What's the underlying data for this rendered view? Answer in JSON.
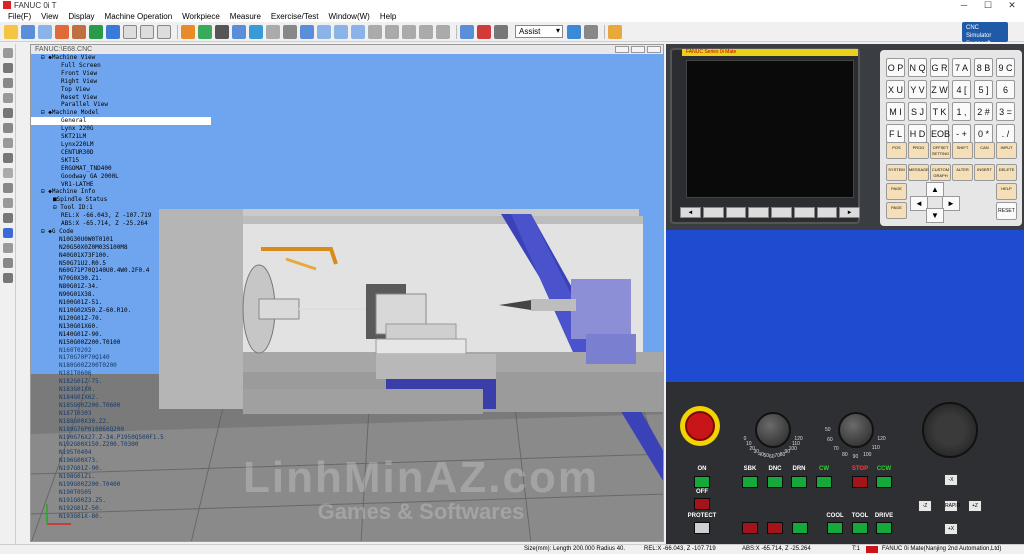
{
  "window": {
    "title": "FANUC 0i T"
  },
  "menu": [
    "File(F)",
    "View",
    "Display",
    "Machine Operation",
    "Workpiece",
    "Measure",
    "Exercise/Test",
    "Window(W)",
    "Help"
  ],
  "toolbar": {
    "mode_select": "Assist"
  },
  "brand": {
    "line1": "CNC Simulator",
    "line2": "Swansoft"
  },
  "inner_window": {
    "title": "FANUC:\\E68.CNC"
  },
  "tree": {
    "machine_view": {
      "label": "Machine View",
      "items": [
        "Full Screen",
        "Front View",
        "Right View",
        "Top View",
        "Reset View",
        "Parallel View"
      ]
    },
    "machine_model": {
      "label": "Machine Model",
      "items": [
        "General",
        "Lynx 220G",
        "SKT21LM",
        "Lynx220LM",
        "CENTUR30D",
        "SKT15",
        "ERGOMAT_TND400",
        "Goodway GA 2000L",
        "VR1-LATHE"
      ]
    },
    "machine_info": {
      "label": "Machine Info",
      "spindle": "Spindle Status",
      "tool": "Tool ID:1",
      "rel": "REL:X  -66.043, Z -107.719",
      "abs": "ABS:X  -65.714, Z  -25.264"
    },
    "gcode": {
      "label": "G Code",
      "lines": [
        "N10G30U0W0T0101",
        "N20G50X0Z0M03S100M8",
        "N40G01X73F100.",
        "N50G71U2.R0.5",
        "N60G71P70Q140U0.4W0.2F0.4",
        "N70G0X30.Z1.",
        "N80G01Z-34.",
        "N90G01X38.",
        "N100G01Z-51.",
        "N110G02X50.Z-60.R10.",
        "N120G01Z-70.",
        "N130G01X60.",
        "N140G01Z-90.",
        "N150G00Z200.T0100",
        "N160T0202",
        "N170G70P70Q140",
        "N180G00Z200T0200",
        "N181T0606",
        "N182G01Z-75.",
        "N183G01X0.",
        "N184G01X62.",
        "N185G00Z200.T0600",
        "N187T0303",
        "N188G00X30.Z2.",
        "N189G76P010060Q200",
        "N190G76X27.Z-34.P1950Q500F1.5",
        "N192G00X150.Z200.T0300",
        "N195T0404",
        "N196G00X73.",
        "N197G01Z-90.",
        "N198G01Z1.",
        "N199G00Z200.T0400",
        "N190T0505",
        "N191G00Z3.Z5.",
        "N192G01Z-50.",
        "N193G01X-80."
      ]
    }
  },
  "cnc_screen": {
    "label": "FANUC  Series 0i Mate"
  },
  "keypad": {
    "keys": [
      "O P",
      "N Q",
      "G R",
      "7 A",
      "8 B",
      "9 C",
      "X U",
      "Y V",
      "Z W",
      "4 [",
      "5 ]",
      "6 SP",
      "M I",
      "S J",
      "T K",
      "1 ,",
      "2 #",
      "3 =",
      "F L",
      "H D",
      "EOB E",
      "- +",
      "0 *",
      ". /"
    ],
    "func_keys": [
      "POS",
      "PROG",
      "OFFSET SETTING",
      "SHIFT",
      "CAN",
      "INPUT",
      "SYSTEM",
      "MESSAGE",
      "CUSTOM GRAPH",
      "ALTER",
      "INSERT",
      "DELETE"
    ],
    "page_up": "PAGE",
    "page_down": "PAGE",
    "help": "HELP",
    "reset": "RESET"
  },
  "operator_panel": {
    "feed_scale": [
      "0",
      "10",
      "20",
      "30",
      "40",
      "50",
      "60",
      "70",
      "80",
      "90",
      "100",
      "110",
      "120"
    ],
    "spindle_scale": [
      "50",
      "60",
      "70",
      "80",
      "90",
      "100",
      "110",
      "120"
    ],
    "buttons_row1": [
      {
        "label": "ON",
        "color": "green"
      },
      {
        "label": "SBK",
        "color": "green"
      },
      {
        "label": "DNC",
        "color": "green"
      },
      {
        "label": "DRN",
        "color": "green"
      },
      {
        "label": "CW",
        "color": "green"
      },
      {
        "label": "STOP",
        "color": "red"
      },
      {
        "label": "CCW",
        "color": "green"
      }
    ],
    "off_label": "OFF",
    "protect_label": "PROTECT",
    "buttons_row3": [
      "COOL",
      "TOOL",
      "DRIVE"
    ],
    "jog_keys": [
      "-X",
      "-Z",
      "RAPID",
      "+Z",
      "+X"
    ]
  },
  "statusbar": {
    "size": "Size(mm): Length 200.000 Radius  40.",
    "rel": "REL:X -66.043, Z -107.719",
    "abs": "ABS:X -65.714, Z -25.264",
    "tool": "T:1",
    "system": "FANUC 0i Mate(Nanjing 2nd Automation,Ltd)"
  },
  "watermark": {
    "line1": "LinhMinAZ.com",
    "line2": "Games & Softwares"
  },
  "colors": {
    "viewport_bg": "#6ea5ee",
    "estop": "#c8151a",
    "green_btn": "#16a83a",
    "blue_panel": "#1f4bd1"
  }
}
